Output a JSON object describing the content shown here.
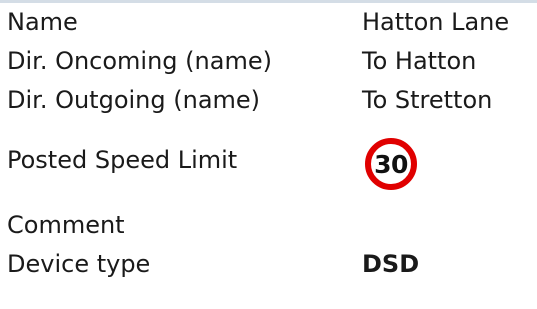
{
  "fields": {
    "name": {
      "label": "Name",
      "value": "Hatton Lane"
    },
    "dir_oncoming": {
      "label": "Dir. Oncoming (name)",
      "value": "To Hatton"
    },
    "dir_outgoing": {
      "label": "Dir. Outgoing (name)",
      "value": "To Stretton"
    },
    "speed_limit": {
      "label": "Posted Speed Limit",
      "value": "30"
    },
    "comment": {
      "label": "Comment",
      "value": ""
    },
    "device_type": {
      "label": "Device type",
      "value": "DSD"
    }
  },
  "colors": {
    "sign_border": "#e00000",
    "text": "#1a1a1a",
    "divider": "#d4dde6"
  },
  "icons": {
    "speed_limit": "speed-limit-sign-icon"
  }
}
